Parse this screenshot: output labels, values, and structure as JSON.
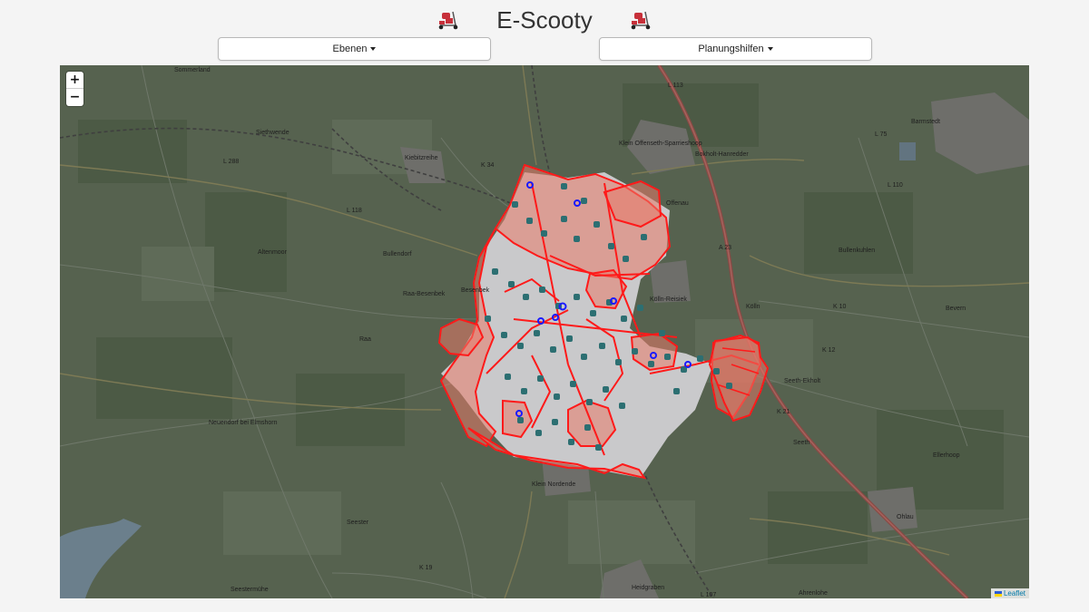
{
  "app": {
    "title": "E-Scooty",
    "logo_icon": "scooter-icon"
  },
  "toolbar": {
    "layers_label": "Ebenen",
    "planning_label": "Planungshilfen"
  },
  "map": {
    "zoom_in": "+",
    "zoom_out": "−",
    "attribution": "Leaflet",
    "colors": {
      "zone_outline": "#ff1a1a",
      "zone_fill": "#e87a6a",
      "station": "#2c6f72",
      "marker": "#1a1aff"
    },
    "place_labels": [
      "Sommerland",
      "Siethwende",
      "L 288",
      "Kiebitzreihe",
      "L 118",
      "Altenmoor",
      "Bullendorf",
      "Raa-Besenbek",
      "Besenbek",
      "Raa",
      "Neuendorf bei Elmshorn",
      "Seester",
      "Seestermühe",
      "K 19",
      "Klein Offenseth-Sparrieshoop",
      "Bokholt-Hanredder",
      "Offenau",
      "A 23",
      "Kölln-Reisiek",
      "Kölln",
      "K 10",
      "Bevern",
      "Barmstedt",
      "L 75",
      "L 110",
      "Bullenkuhlen",
      "K 12",
      "Seeth-Ekholt",
      "K 21",
      "Seeth",
      "Ellerhoop",
      "Klein Nordende",
      "Heidgraben",
      "L 107",
      "Ahrenlohe",
      "Ohlau",
      "L 113",
      "K 34"
    ]
  }
}
